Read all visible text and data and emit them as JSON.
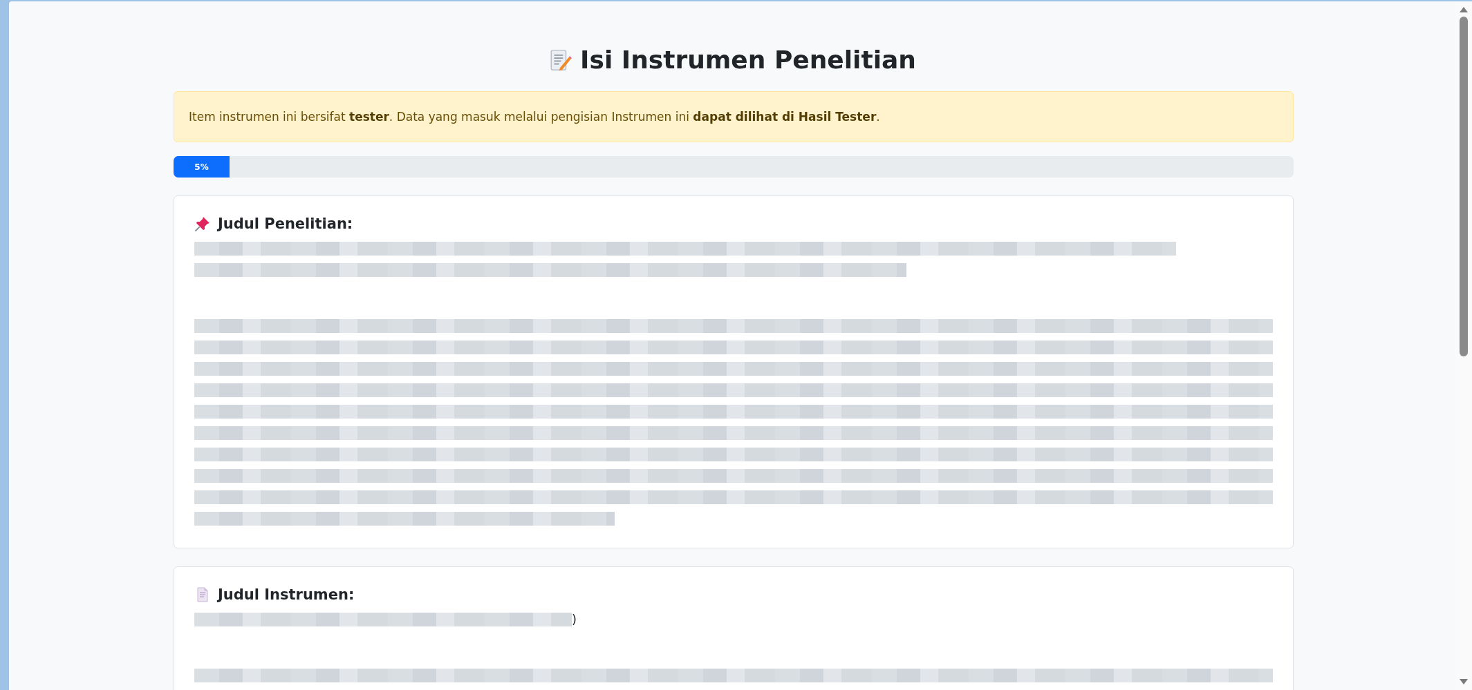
{
  "title": {
    "text": "Isi Instrumen Penelitian"
  },
  "notice": {
    "text": "Item instrumen ini bersifat **tester**. Data yang masuk melalui pengisian Instrumen ini **dapat dilihat di Hasil Tester**."
  },
  "progress": {
    "level": 0.05,
    "label": "5%"
  },
  "cards": [
    {
      "kind": "research",
      "heading": "Judul Penelitian:"
    },
    {
      "kind": "instrument",
      "heading": "Judul Instrumen:",
      "trailing_text": ")"
    }
  ]
}
